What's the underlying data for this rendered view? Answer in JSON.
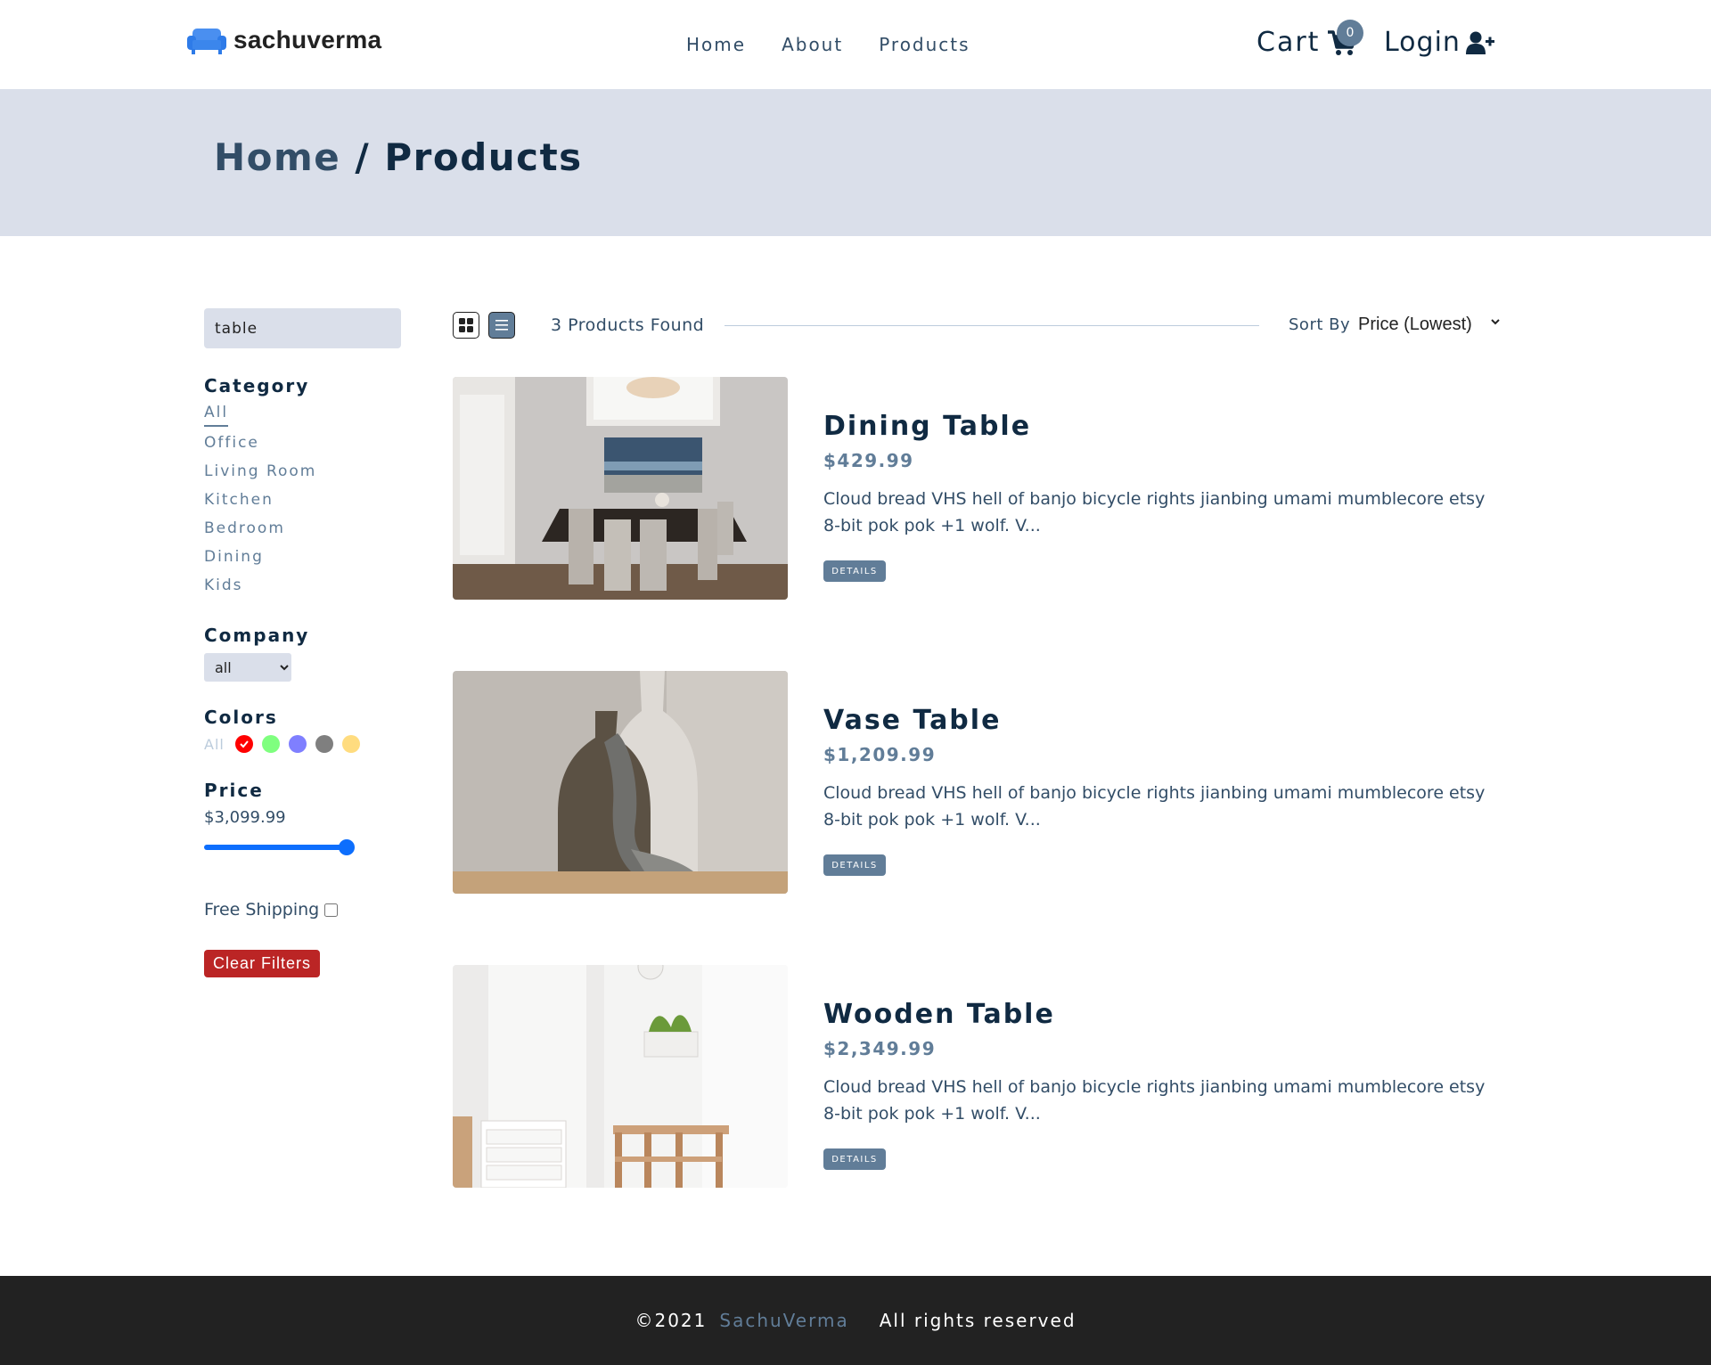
{
  "brand": {
    "name": "sachuverma"
  },
  "nav": {
    "links": [
      {
        "label": "Home"
      },
      {
        "label": "About"
      },
      {
        "label": "Products"
      }
    ],
    "cart_label": "Cart",
    "cart_count": "0",
    "login_label": "Login"
  },
  "hero": {
    "home_link": "Home",
    "separator": " / ",
    "current": "Products"
  },
  "filters": {
    "search_value": "table",
    "category_title": "Category",
    "categories": [
      "All",
      "Office",
      "Living Room",
      "Kitchen",
      "Bedroom",
      "Dining",
      "Kids"
    ],
    "company_title": "Company",
    "company_selected": "all",
    "colors_title": "Colors",
    "colors_all_label": "All",
    "colors": [
      "#ff0000",
      "#00ff00",
      "#0000ff",
      "#000000",
      "#ffb900"
    ],
    "price_title": "Price",
    "price_value": "$3,099.99",
    "price_fraction": 1.0,
    "free_shipping_label": "Free Shipping",
    "clear_label": "Clear Filters"
  },
  "toolbar": {
    "found_text": "3 Products Found",
    "sort_label": "Sort By",
    "sort_selected": "Price (Lowest)"
  },
  "products": [
    {
      "name": "Dining Table",
      "price": "$429.99",
      "desc": "Cloud bread VHS hell of banjo bicycle rights jianbing umami mumblecore etsy 8-bit pok pok +1 wolf. V...",
      "details_label": "DETAILS"
    },
    {
      "name": "Vase Table",
      "price": "$1,209.99",
      "desc": "Cloud bread VHS hell of banjo bicycle rights jianbing umami mumblecore etsy 8-bit pok pok +1 wolf. V...",
      "details_label": "DETAILS"
    },
    {
      "name": "Wooden Table",
      "price": "$2,349.99",
      "desc": "Cloud bread VHS hell of banjo bicycle rights jianbing umami mumblecore etsy 8-bit pok pok +1 wolf. V...",
      "details_label": "DETAILS"
    }
  ],
  "footer": {
    "copyright": "©2021",
    "brand": "SachuVerma",
    "rights": "All rights reserved"
  },
  "colors": {
    "primary": "#617d98",
    "hero_bg": "#dadfea",
    "danger": "#bb2525",
    "footer_bg": "#222222"
  }
}
